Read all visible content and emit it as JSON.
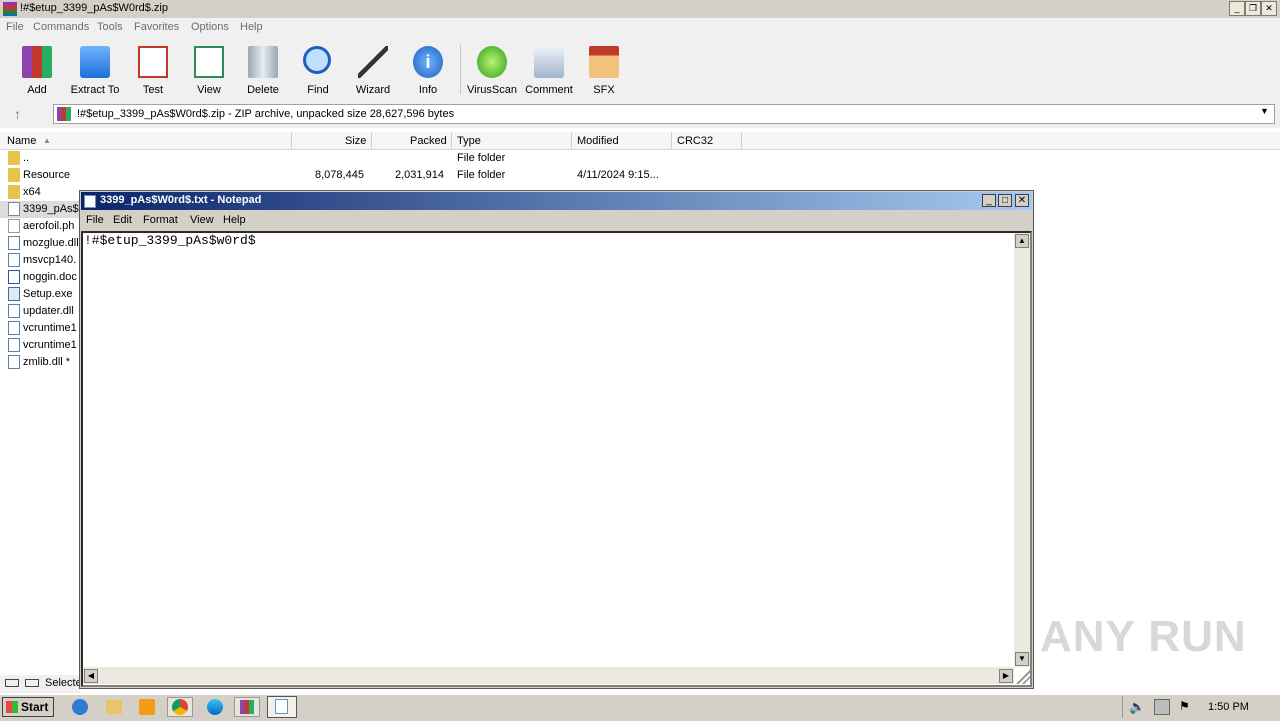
{
  "winrar": {
    "title": "!#$etup_3399_pAs$W0rd$.zip",
    "menu": [
      "File",
      "Commands",
      "Tools",
      "Favorites",
      "Options",
      "Help"
    ],
    "toolbar": [
      {
        "label": "Add",
        "icon": "winrar-add-icon"
      },
      {
        "label": "Extract To",
        "icon": "extract-folder-icon"
      },
      {
        "label": "Test",
        "icon": "test-checklist-icon"
      },
      {
        "label": "View",
        "icon": "view-book-icon"
      },
      {
        "label": "Delete",
        "icon": "trash-icon"
      },
      {
        "label": "Find",
        "icon": "magnifier-icon"
      },
      {
        "label": "Wizard",
        "icon": "wand-icon"
      },
      {
        "label": "Info",
        "icon": "info-icon"
      },
      {
        "label": "VirusScan",
        "icon": "virus-scan-icon"
      },
      {
        "label": "Comment",
        "icon": "comment-icon"
      },
      {
        "label": "SFX",
        "icon": "sfx-box-icon"
      }
    ],
    "address": "!#$etup_3399_pAs$W0rd$.zip - ZIP archive, unpacked size 28,627,596 bytes",
    "columns": [
      "Name",
      "Size",
      "Packed",
      "Type",
      "Modified",
      "CRC32"
    ],
    "files": [
      {
        "name": "..",
        "size": "",
        "packed": "",
        "type": "File folder",
        "modified": "",
        "icon": "folder"
      },
      {
        "name": "Resource",
        "size": "8,078,445",
        "packed": "2,031,914",
        "type": "File folder",
        "modified": "4/11/2024 9:15...",
        "icon": "folder"
      },
      {
        "name": "x64",
        "size": "",
        "packed": "",
        "type": "",
        "modified": "",
        "icon": "folder"
      },
      {
        "name": "3399_pAs$",
        "size": "",
        "packed": "",
        "type": "",
        "modified": "",
        "icon": "txt"
      },
      {
        "name": "aerofoil.ph",
        "size": "",
        "packed": "",
        "type": "",
        "modified": "",
        "icon": "file"
      },
      {
        "name": "mozglue.dll",
        "size": "",
        "packed": "",
        "type": "",
        "modified": "",
        "icon": "dll"
      },
      {
        "name": "msvcp140.",
        "size": "",
        "packed": "",
        "type": "",
        "modified": "",
        "icon": "dll"
      },
      {
        "name": "noggin.doc",
        "size": "",
        "packed": "",
        "type": "",
        "modified": "",
        "icon": "doc"
      },
      {
        "name": "Setup.exe",
        "size": "",
        "packed": "",
        "type": "",
        "modified": "",
        "icon": "exe"
      },
      {
        "name": "updater.dll",
        "size": "",
        "packed": "",
        "type": "",
        "modified": "",
        "icon": "dll"
      },
      {
        "name": "vcruntime1",
        "size": "",
        "packed": "",
        "type": "",
        "modified": "",
        "icon": "dll"
      },
      {
        "name": "vcruntime1",
        "size": "",
        "packed": "",
        "type": "",
        "modified": "",
        "icon": "dll"
      },
      {
        "name": "zmlib.dll *",
        "size": "",
        "packed": "",
        "type": "",
        "modified": "",
        "icon": "dll"
      }
    ],
    "status": "Selecte"
  },
  "notepad": {
    "title": "3399_pAs$W0rd$.txt - Notepad",
    "menu": [
      "File",
      "Edit",
      "Format",
      "View",
      "Help"
    ],
    "content": "!#$etup_3399_pAs$w0rd$"
  },
  "taskbar": {
    "start_label": "Start",
    "clock": "1:50 PM"
  },
  "watermark": "ANY RUN"
}
